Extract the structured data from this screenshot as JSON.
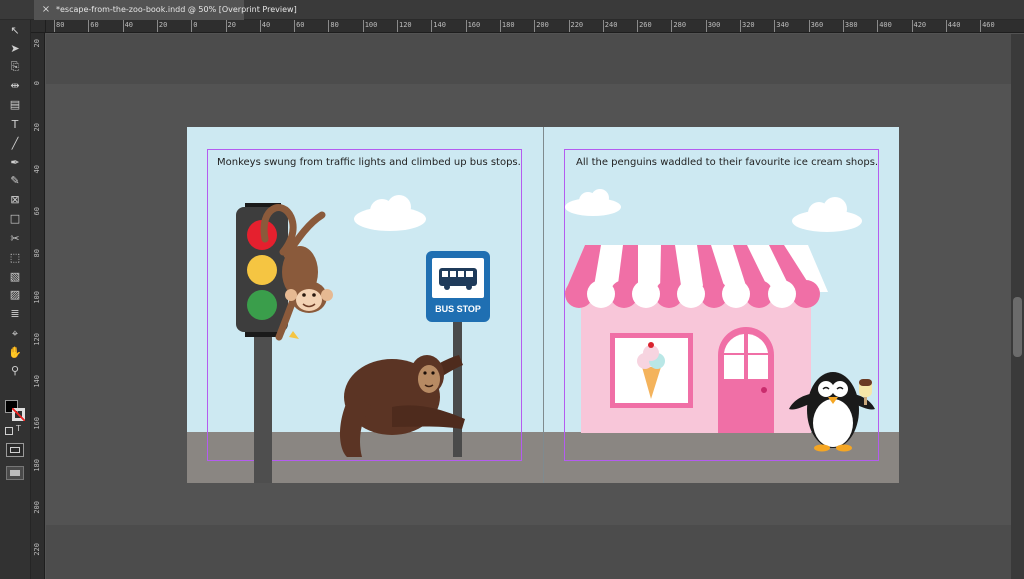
{
  "document": {
    "tab_title": "*escape-from-the-zoo-book.indd @ 50% [Overprint Preview]",
    "close_glyph": "×"
  },
  "ruler": {
    "horizontal_labels": [
      "80",
      "60",
      "40",
      "20",
      "0",
      "20",
      "40",
      "60",
      "80",
      "100",
      "120",
      "140",
      "160",
      "180",
      "200",
      "220",
      "240",
      "260",
      "280",
      "300",
      "320",
      "340",
      "360",
      "380",
      "400",
      "420",
      "440",
      "460"
    ],
    "vertical_labels": [
      "20",
      "0",
      "20",
      "40",
      "60",
      "80",
      "100",
      "120",
      "140",
      "160",
      "180",
      "200",
      "220"
    ]
  },
  "tools": [
    {
      "name": "selection-tool",
      "glyph": "↖"
    },
    {
      "name": "direct-selection-tool",
      "glyph": "➤"
    },
    {
      "name": "page-tool",
      "glyph": "⎘"
    },
    {
      "name": "gap-tool",
      "glyph": "⇹"
    },
    {
      "name": "content-collector-tool",
      "glyph": "▤"
    },
    {
      "name": "type-tool",
      "glyph": "T"
    },
    {
      "name": "line-tool",
      "glyph": "╱"
    },
    {
      "name": "pen-tool",
      "glyph": "✒"
    },
    {
      "name": "pencil-tool",
      "glyph": "✎"
    },
    {
      "name": "rectangle-frame-tool",
      "glyph": "⊠"
    },
    {
      "name": "rectangle-tool",
      "glyph": "□"
    },
    {
      "name": "scissors-tool",
      "glyph": "✂"
    },
    {
      "name": "free-transform-tool",
      "glyph": "⬚"
    },
    {
      "name": "gradient-swatch-tool",
      "glyph": "▧"
    },
    {
      "name": "gradient-feather-tool",
      "glyph": "▨"
    },
    {
      "name": "note-tool",
      "glyph": "≣"
    },
    {
      "name": "eyedropper-tool",
      "glyph": "⌖"
    },
    {
      "name": "hand-tool",
      "glyph": "✋"
    },
    {
      "name": "zoom-tool",
      "glyph": "⚲"
    }
  ],
  "pages": {
    "left_caption": "Monkeys swung from traffic lights and climbed up bus stops.",
    "right_caption": "All the penguins waddled to their favourite ice cream shops.",
    "bus_stop_label": "BUS STOP"
  },
  "colors": {
    "sky": "#cde9f2",
    "road": "#8a8682",
    "margin_guide": "#b45cf0",
    "awning_pink": "#f06fa6",
    "shop_pink": "#f8c6d9"
  }
}
